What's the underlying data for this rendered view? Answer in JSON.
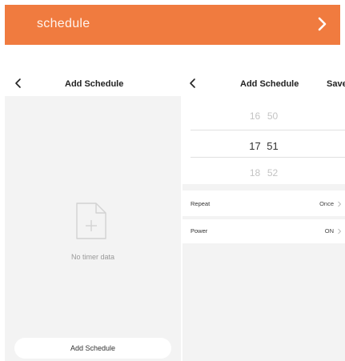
{
  "banner": {
    "title": "schedule",
    "color": "#f07b3f",
    "icon": "chevron-right-icon"
  },
  "screen1": {
    "header": {
      "back_icon": "back-arrow-icon",
      "title": "Add Schedule"
    },
    "empty_state": {
      "icon": "empty-file-plus-icon",
      "text": "No timer data"
    },
    "add_button_label": "Add Schedule"
  },
  "screen2": {
    "header": {
      "back_icon": "back-arrow-icon",
      "title": "Add Schedule",
      "save_label": "Save"
    },
    "picker": {
      "above": {
        "hour": "16",
        "minute": "50"
      },
      "selected": {
        "hour": "17",
        "minute": "51"
      },
      "below": {
        "hour": "18",
        "minute": "52"
      }
    },
    "repeat": {
      "label": "Repeat",
      "value": "Once"
    },
    "power": {
      "label": "Power",
      "value": "ON"
    }
  }
}
